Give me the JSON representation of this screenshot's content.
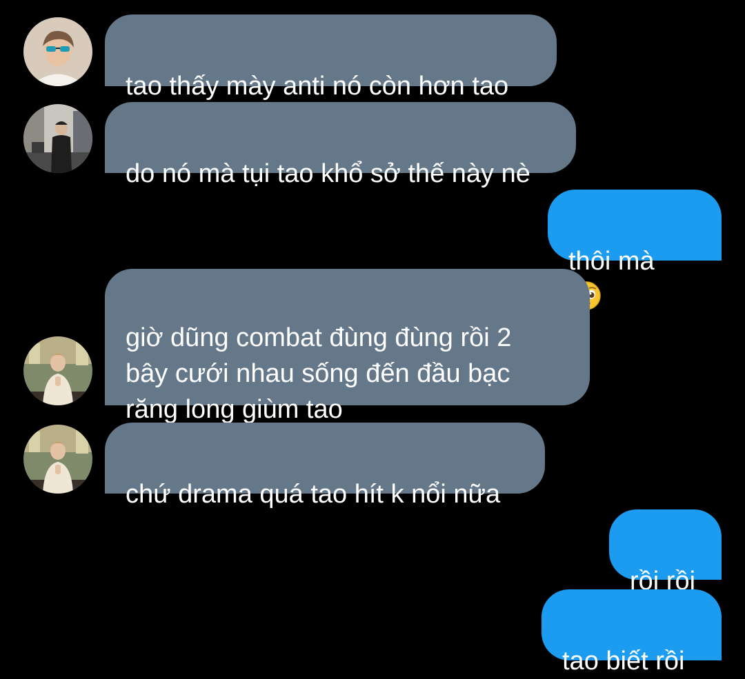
{
  "colors": {
    "background": "#000000",
    "incoming_bubble": "#65788a",
    "outgoing_bubble": "#1c9cf0",
    "text": "#ffffff"
  },
  "messages": [
    {
      "direction": "incoming",
      "text": "tao thấy mày anti nó còn hơn tao"
    },
    {
      "direction": "incoming",
      "text": "do nó mà tụi tao khổ sở thế này nè"
    },
    {
      "direction": "outgoing",
      "text": "thôi mà",
      "emoji": "pleading-face-icon"
    },
    {
      "direction": "incoming",
      "text": "giờ dũng combat đùng đùng rồi 2\nbây cưới nhau sống đến đầu bạc\nrăng long giùm tao"
    },
    {
      "direction": "incoming",
      "text": "chứ drama quá tao hít k nổi nữa"
    },
    {
      "direction": "outgoing",
      "text": "rồi rồi"
    },
    {
      "direction": "outgoing",
      "text": "tao biết rồi"
    }
  ]
}
